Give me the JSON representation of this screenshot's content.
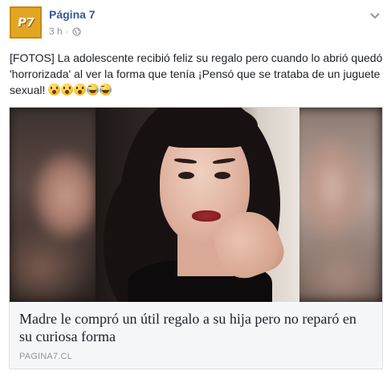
{
  "post": {
    "page_name": "Página 7",
    "avatar_text": "P7",
    "time": "3 h",
    "separator": "·",
    "text": "[FOTOS] La adolescente recibió feliz su regalo pero cuando lo abrió quedó 'horrorizada' al ver la forma que tenía ¡Pensó que se trataba de un juguete sexual!",
    "emojis": [
      "astonished-face-icon",
      "astonished-face-icon",
      "hushed-face-icon",
      "tears-of-joy-icon",
      "tears-of-joy-icon"
    ]
  },
  "link_card": {
    "title": "Madre le compró un útil regalo a su hija pero no reparó en su curiosa forma",
    "domain": "PAGINA7.CL"
  },
  "colors": {
    "page_name": "#365899",
    "meta": "#90949c",
    "avatar": "#e3a623",
    "caption_bg": "#f6f7f9"
  }
}
